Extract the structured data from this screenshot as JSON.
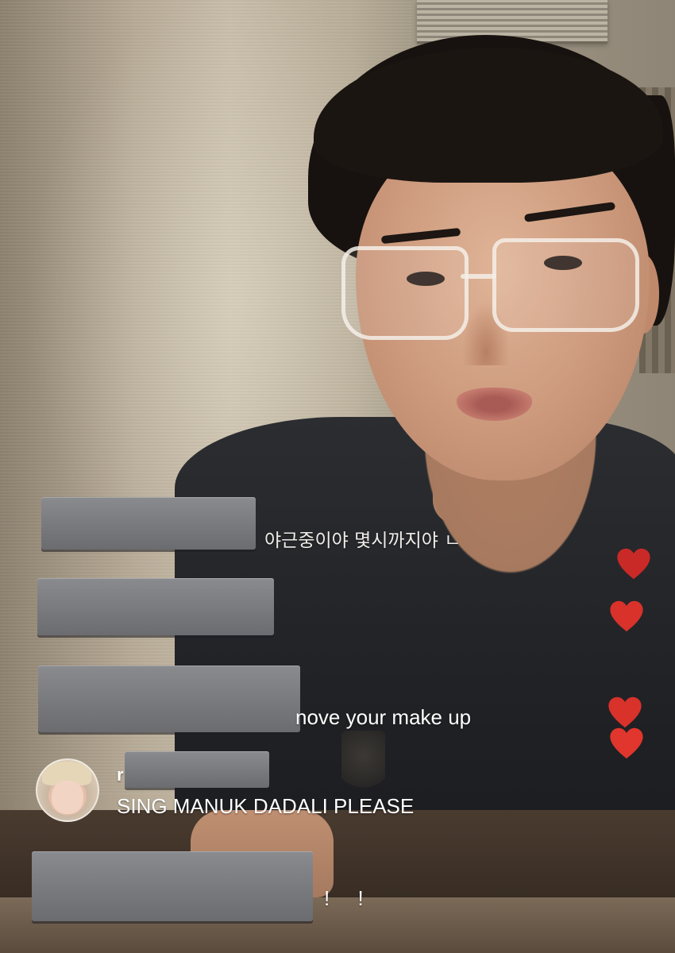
{
  "comments": [
    {
      "text": "야근중이야 몇시까지야 ㄴ"
    },
    {
      "text": ""
    },
    {
      "text": "nove your make up"
    },
    {
      "username_visible": "r",
      "text": "SING MANUK DADALI PLEASE"
    },
    {
      "text": "! !"
    }
  ],
  "reactions": {
    "heart_count": 4,
    "heart_color": "#d8322b"
  },
  "icons": {
    "heart": "heart-icon",
    "avatar": "user-avatar"
  }
}
